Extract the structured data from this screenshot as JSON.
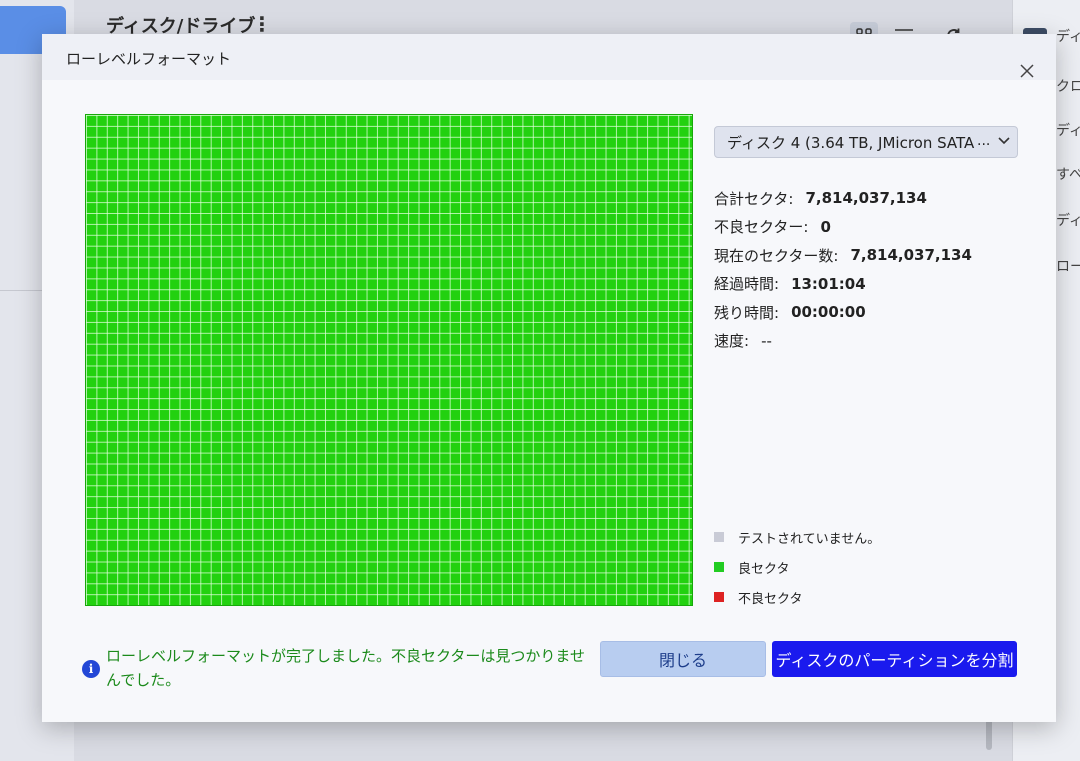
{
  "background": {
    "header_title": "ディスク/ドライブ",
    "kebab_glyph": "⋮",
    "right_items": [
      "ディ",
      "クロ",
      "ディ",
      "すべ",
      "ディ",
      "ロー"
    ]
  },
  "dialog": {
    "title": "ローレベルフォーマット",
    "disk_select": {
      "value": "ディスク 4 (3.64 TB, JMicron  SATA",
      "ellipsis": "..."
    },
    "stats": [
      {
        "label": "合計セクタ:",
        "value": "7,814,037,134"
      },
      {
        "label": "不良セクター:",
        "value": "0"
      },
      {
        "label": "現在のセクター数:",
        "value": "7,814,037,134"
      },
      {
        "label": "経過時間:",
        "value": "13:01:04"
      },
      {
        "label": "残り時間:",
        "value": "00:00:00"
      },
      {
        "label": "速度:",
        "value": "--"
      }
    ],
    "legend": [
      {
        "label": "テストされていません。",
        "color": "#c9cbd6"
      },
      {
        "label": "良セクタ",
        "color": "#22cc22"
      },
      {
        "label": "不良セクタ",
        "color": "#dd2222"
      }
    ],
    "info_glyph": "i",
    "status_message": "ローレベルフォーマットが完了しました。不良セクターは見つかりませんでした。",
    "buttons": {
      "close": "閉じる",
      "split": "ディスクのパーティションを分割"
    }
  },
  "colors": {
    "good_sector": "#22d10f",
    "primary": "#1a1aee",
    "status_text": "#1b8a1b"
  }
}
